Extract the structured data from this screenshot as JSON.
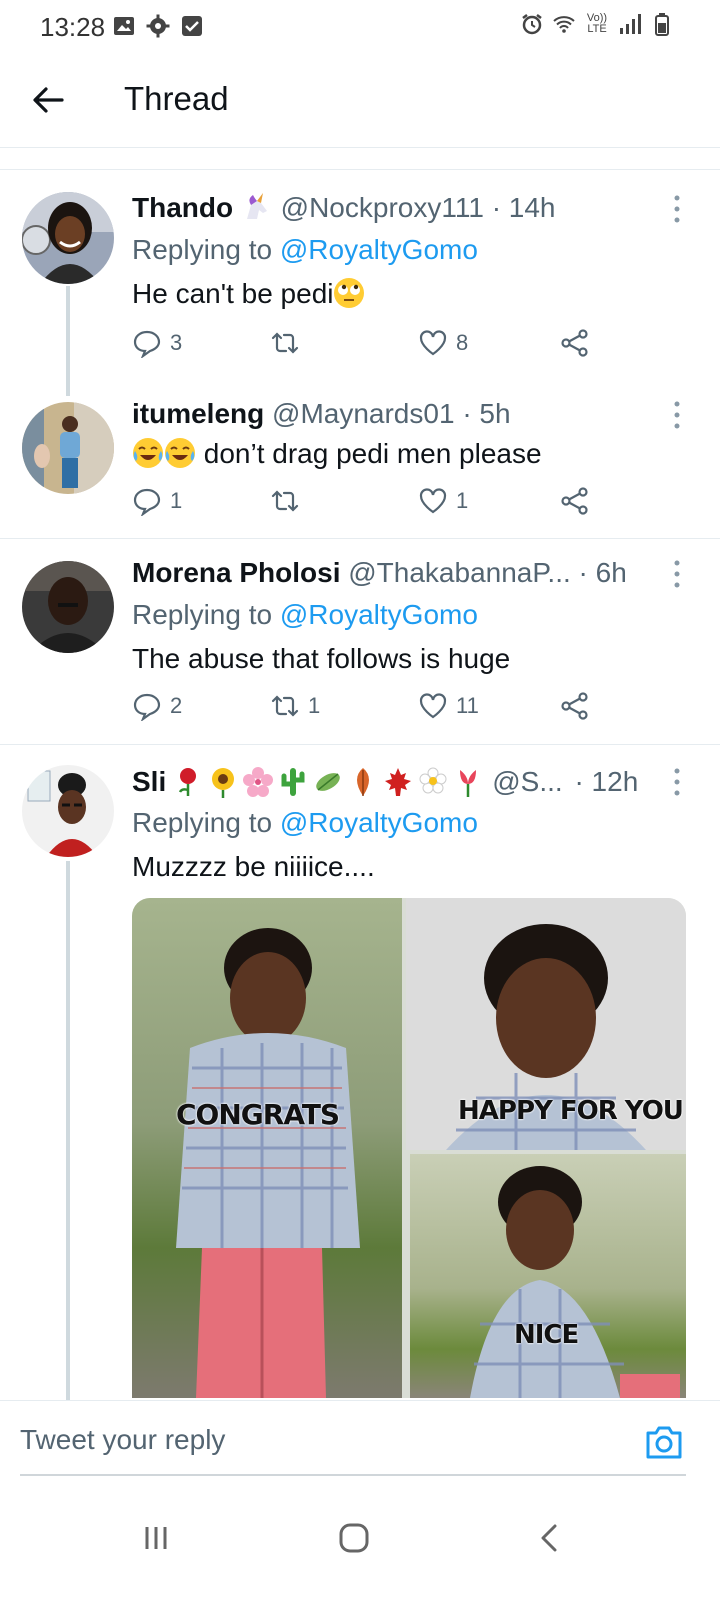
{
  "status_bar": {
    "time": "13:28",
    "left_icons": [
      "image-icon",
      "gear-icon",
      "check-box-icon"
    ],
    "right_icons": [
      "alarm-icon",
      "wifi-icon",
      "volte-icon",
      "signal-icon",
      "battery-icon"
    ],
    "volte_label": "Vo)) LTE"
  },
  "header": {
    "title": "Thread"
  },
  "tweets": [
    {
      "name": "Thando",
      "name_emoji": "unicorn",
      "handle": "@Nockproxy111",
      "time": "· 14h",
      "replying_prefix": "Replying to ",
      "replying_to": "@RoyaltyGomo",
      "text": "He can't be pedi",
      "text_emoji": "face-with-rolling-eyes",
      "replies": "3",
      "retweets": "",
      "likes": "8"
    },
    {
      "name": "itumeleng",
      "handle": "@Maynards01",
      "time": "· 5h",
      "text_emoji": "joy-joy",
      "text": " don’t drag pedi men please",
      "replies": "1",
      "retweets": "",
      "likes": "1"
    },
    {
      "name": "Morena Pholosi",
      "handle": "@ThakabannaP...",
      "time": "· 6h",
      "replying_prefix": "Replying to ",
      "replying_to": "@RoyaltyGomo",
      "text": "The abuse that follows is huge",
      "replies": "2",
      "retweets": "1",
      "likes": "11"
    },
    {
      "name": "Sli",
      "name_emojis": [
        "rose",
        "sunflower",
        "cherry-blossom",
        "cactus",
        "leaf-fluttering",
        "fallen-leaf",
        "maple-leaf",
        "blossom",
        "tulip"
      ],
      "handle": "@S...",
      "time": "· 12h",
      "replying_prefix": "Replying to ",
      "replying_to": "@RoyaltyGomo",
      "text": "Muzzzz be niiiice....",
      "media_captions": [
        "CONGRATS",
        "HAPPY FOR YOU",
        "NICE"
      ]
    }
  ],
  "compose": {
    "placeholder": "Tweet your reply"
  },
  "nav": [
    "recent-apps-icon",
    "home-icon",
    "back-icon"
  ],
  "colors": {
    "accent": "#1d9bf0",
    "secondary_text": "#536471",
    "primary_text": "#0f1419",
    "divider": "#e6ecf0"
  }
}
